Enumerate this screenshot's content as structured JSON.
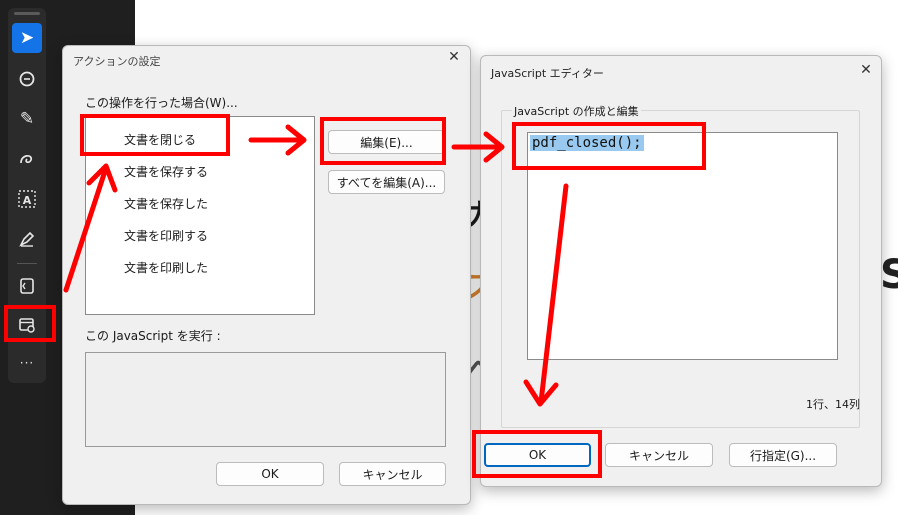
{
  "toolbar": {
    "items": [
      {
        "name": "select",
        "icon": "select-arrow-icon",
        "glyph": "➤"
      },
      {
        "name": "comment",
        "icon": "comment-icon",
        "glyph": "💬"
      },
      {
        "name": "highlight",
        "icon": "highlighter-icon",
        "glyph": "✎"
      },
      {
        "name": "draw",
        "icon": "freehand-draw-icon",
        "glyph": "ℓ"
      },
      {
        "name": "text",
        "icon": "text-select-icon",
        "glyph": "A"
      },
      {
        "name": "sign",
        "icon": "fill-sign-icon",
        "glyph": "✒"
      },
      {
        "name": "stamp",
        "icon": "document-scan-icon",
        "glyph": "⎘"
      },
      {
        "name": "action",
        "icon": "action-settings-icon",
        "glyph": "⚙"
      }
    ],
    "more_label": "···"
  },
  "action_dialog": {
    "title": "アクションの設定",
    "close_label": "✕",
    "trigger_label": "この操作を行った場合(W)...",
    "triggers": [
      "文書を閉じる",
      "文書を保存する",
      "文書を保存した",
      "文書を印刷する",
      "文書を印刷した"
    ],
    "edit_button": "編集(E)...",
    "edit_all_button": "すべてを編集(A)...",
    "run_js_label": "この JavaScript を実行 :",
    "ok_button": "OK",
    "cancel_button": "キャンセル"
  },
  "js_editor": {
    "title": "JavaScript エディター",
    "close_label": "✕",
    "group_label": "JavaScript の作成と編集",
    "code": "pdf_closed();",
    "position_status": "1行、14列",
    "ok_button": "OK",
    "cancel_button": "キャンセル",
    "goto_line_button": "行指定(G)..."
  },
  "colors": {
    "annotation": "#ff0000",
    "selection": "#99c9ef",
    "accent": "#1473e6"
  }
}
